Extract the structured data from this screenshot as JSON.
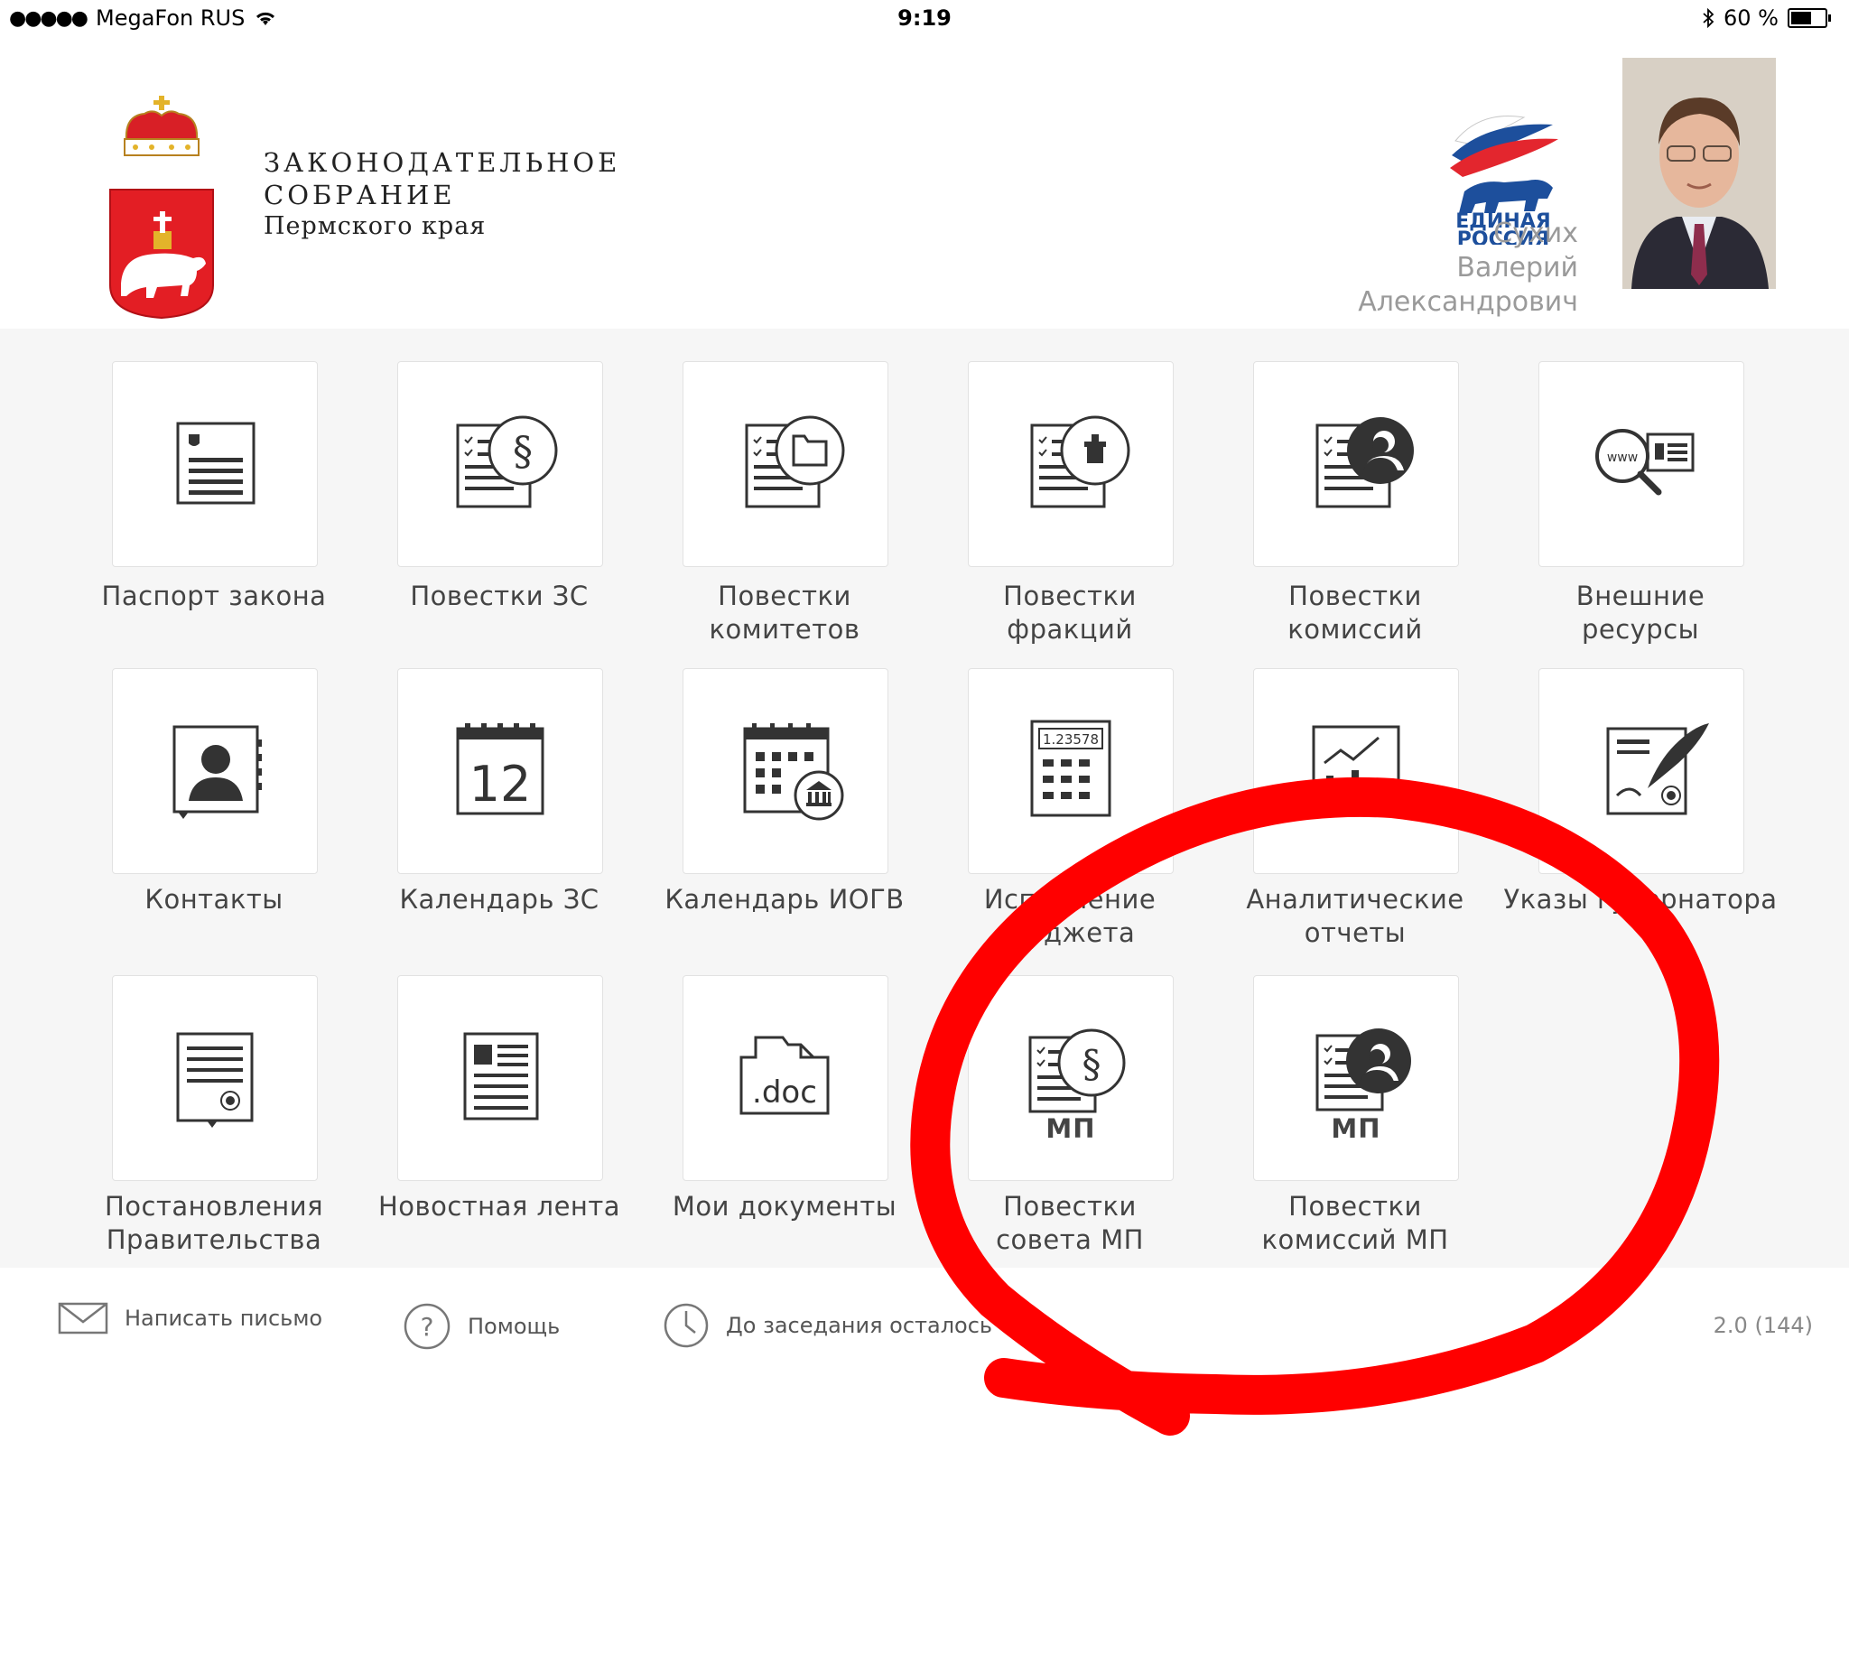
{
  "status_bar": {
    "signal": "●●●●●",
    "carrier": "MegaFon RUS",
    "time": "9:19",
    "battery": "60 %",
    "battery_level": 0.6
  },
  "header": {
    "org_line1": "ЗАКОНОДАТЕЛЬНОЕ",
    "org_line2": "СОБРАНИЕ",
    "org_line3": "Пермского края",
    "party_logo_text1": "ЕДИНАЯ",
    "party_logo_text2": "РОССИЯ",
    "person_surname": "Сухих",
    "person_name": "Валерий",
    "person_patronymic": "Александрович"
  },
  "tiles": [
    {
      "label1": "Паспорт закона",
      "label2": "",
      "icon": "law-passport-icon"
    },
    {
      "label1": "Повестки ЗС",
      "label2": "",
      "icon": "agenda-paragraph-icon"
    },
    {
      "label1": "Повестки",
      "label2": "комитетов",
      "icon": "agenda-folder-icon"
    },
    {
      "label1": "Повестки",
      "label2": "фракций",
      "icon": "agenda-faction-icon"
    },
    {
      "label1": "Повестки",
      "label2": "комиссий",
      "icon": "agenda-commission-icon"
    },
    {
      "label1": "Внешние",
      "label2": "ресурсы",
      "icon": "www-search-icon"
    },
    {
      "label1": "Контакты",
      "label2": "",
      "icon": "contacts-icon"
    },
    {
      "label1": "Календарь ЗС",
      "label2": "",
      "icon": "calendar-icon",
      "calendar_day": "12"
    },
    {
      "label1": "Календарь ИОГВ",
      "label2": "",
      "icon": "calendar-government-icon"
    },
    {
      "label1": "Исполнение",
      "label2": "бюджета",
      "icon": "calculator-icon",
      "calc_value": "1.23578"
    },
    {
      "label1": "Аналитические",
      "label2": "отчеты",
      "icon": "analytics-chart-icon"
    },
    {
      "label1": "Указы губернатора",
      "label2": "",
      "icon": "decree-quill-icon"
    },
    {
      "label1": "Постановления",
      "label2": "Правительства",
      "icon": "resolution-icon"
    },
    {
      "label1": "Новостная лента",
      "label2": "",
      "icon": "news-icon"
    },
    {
      "label1": "Мои документы",
      "label2": "",
      "icon": "doc-file-icon",
      "doc_text": ".doc"
    },
    {
      "label1": "Повестки",
      "label2": "совета МП",
      "icon": "agenda-paragraph-mp-icon",
      "mp": "МП"
    },
    {
      "label1": "Повестки",
      "label2": "комиссий МП",
      "icon": "agenda-commission-mp-icon",
      "mp": "МП"
    }
  ],
  "footer": {
    "write_letter": "Написать письмо",
    "help": "Помощь",
    "countdown": "До заседания осталось 0 ч.",
    "version": "2.0 (144)"
  },
  "colors": {
    "annotation": "#ff0000",
    "coat_red": "#e31e24",
    "party_blue": "#1d4f9c"
  }
}
